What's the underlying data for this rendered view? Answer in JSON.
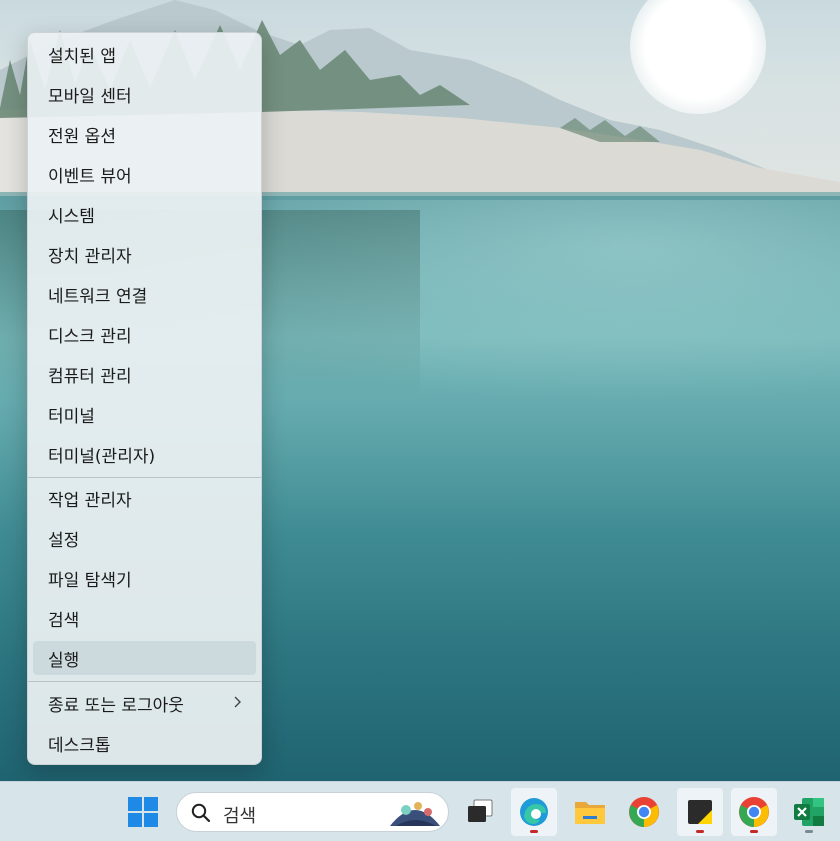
{
  "context_menu": {
    "items": [
      {
        "label": "설치된 앱"
      },
      {
        "label": "모바일 센터"
      },
      {
        "label": "전원 옵션"
      },
      {
        "label": "이벤트 뷰어"
      },
      {
        "label": "시스템"
      },
      {
        "label": "장치 관리자"
      },
      {
        "label": "네트워크 연결"
      },
      {
        "label": "디스크 관리"
      },
      {
        "label": "컴퓨터 관리"
      },
      {
        "label": "터미널"
      },
      {
        "label": "터미널(관리자)"
      },
      {
        "label": "작업 관리자"
      },
      {
        "label": "설정"
      },
      {
        "label": "파일 탐색기"
      },
      {
        "label": "검색"
      },
      {
        "label": "실행"
      },
      {
        "label": "종료 또는 로그아웃"
      },
      {
        "label": "데스크톱"
      }
    ],
    "hovered_item": "실행",
    "submenu_item": "종료 또는 로그아웃"
  },
  "taskbar": {
    "search": {
      "placeholder": "검색"
    },
    "apps": [
      {
        "icon": "windows-start-icon"
      },
      {
        "icon": "search-icon"
      },
      {
        "icon": "task-view-icon"
      },
      {
        "icon": "edge-icon",
        "running": true,
        "active": true
      },
      {
        "icon": "file-explorer-icon"
      },
      {
        "icon": "chrome-icon"
      },
      {
        "icon": "sticky-notes-icon",
        "running": true,
        "active": true
      },
      {
        "icon": "chrome-icon",
        "running": true,
        "active": true
      },
      {
        "icon": "excel-icon",
        "running": true
      }
    ]
  },
  "colors": {
    "menu_background": "#ecf1f3",
    "taskbar_background": "#d7e4ea",
    "running_indicator": "#c32b2b",
    "windows_blue": "#1f8ae6"
  }
}
